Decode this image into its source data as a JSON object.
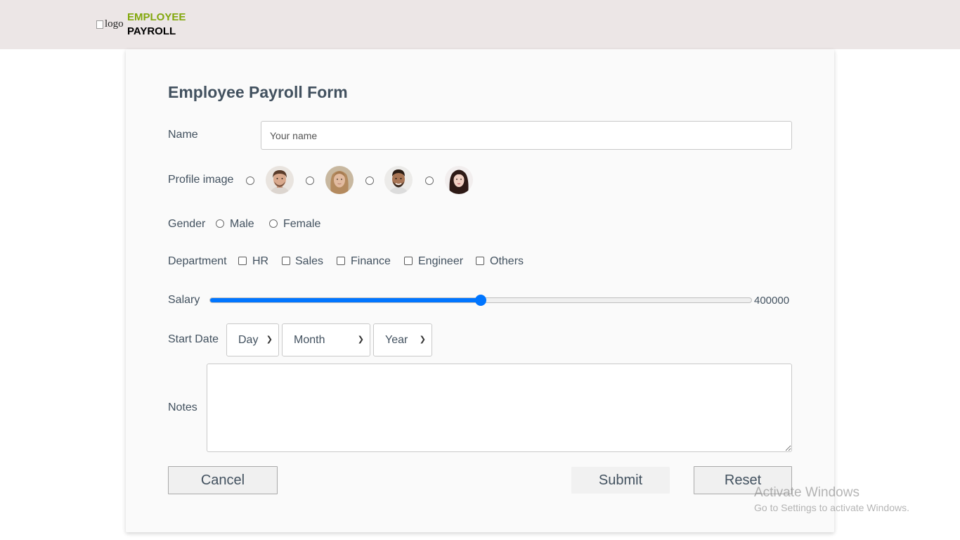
{
  "header": {
    "logo_alt": "logo",
    "brand_line1": "EMPLOYEE",
    "brand_line2": "PAYROLL"
  },
  "form": {
    "title": "Employee Payroll Form",
    "name": {
      "label": "Name",
      "placeholder": "Your name",
      "value": ""
    },
    "profile": {
      "label": "Profile image",
      "options": [
        "profile-1",
        "profile-2",
        "profile-3",
        "profile-4"
      ]
    },
    "gender": {
      "label": "Gender",
      "options": [
        "Male",
        "Female"
      ]
    },
    "department": {
      "label": "Department",
      "options": [
        "HR",
        "Sales",
        "Finance",
        "Engineer",
        "Others"
      ]
    },
    "salary": {
      "label": "Salary",
      "value": "400000",
      "fraction": 0.5
    },
    "start_date": {
      "label": "Start Date",
      "day": "Day",
      "month": "Month",
      "year": "Year"
    },
    "notes": {
      "label": "Notes",
      "value": ""
    },
    "buttons": {
      "cancel": "Cancel",
      "submit": "Submit",
      "reset": "Reset"
    }
  },
  "watermark": {
    "line1": "Activate Windows",
    "line2": "Go to Settings to activate Windows."
  },
  "colors": {
    "header_bg": "#ece6e6",
    "brand_green": "#82a70c",
    "accent_blue": "#0075ff",
    "text": "#42515f"
  }
}
